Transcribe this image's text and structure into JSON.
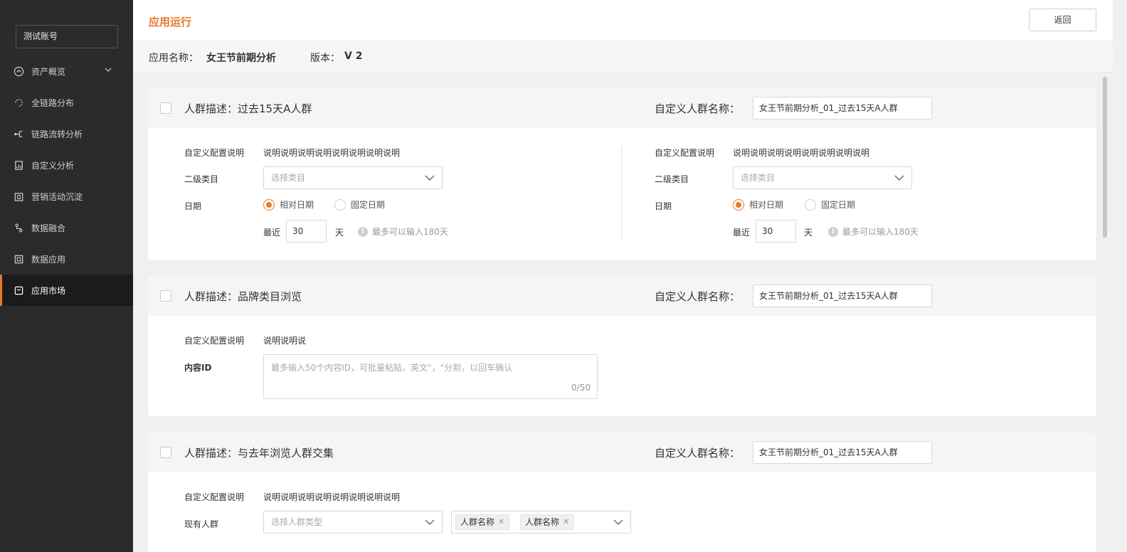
{
  "sidebar": {
    "account": "测试账号",
    "items": [
      {
        "label": "资产概览",
        "icon": "dashboard-icon",
        "active": false,
        "has_children": true
      },
      {
        "label": "全链路分布",
        "icon": "loop-icon",
        "active": false
      },
      {
        "label": "链路流转分析",
        "icon": "flow-icon",
        "active": false
      },
      {
        "label": "自定义分析",
        "icon": "report-icon",
        "active": false
      },
      {
        "label": "营销活动沉淀",
        "icon": "campaign-icon",
        "active": false
      },
      {
        "label": "数据融合",
        "icon": "merge-icon",
        "active": false
      },
      {
        "label": "数据应用",
        "icon": "data-app-icon",
        "active": false
      },
      {
        "label": "应用市场",
        "icon": "market-icon",
        "active": true
      }
    ]
  },
  "header": {
    "title": "应用运行",
    "back_label": "返回"
  },
  "info": {
    "app_name_label": "应用名称：",
    "app_name": "女王节前期分析",
    "version_label": "版本：",
    "version": "V 2"
  },
  "cards": [
    {
      "desc": "人群描述：过去15天A人群",
      "custom_name_label": "自定义人群名称：",
      "custom_name_value": "女王节前期分析_01_过去15天A人群",
      "columns": [
        {
          "config_label": "自定义配置说明",
          "config_value": "说明说明说明说明说明说明说明说明",
          "category_label": "二级类目",
          "category_placeholder": "选择类目",
          "date_label": "日期",
          "radio_relative": "相对日期",
          "radio_fixed": "固定日期",
          "recent_label": "最近",
          "recent_value": "30",
          "unit": "天",
          "hint": "最多可以输入180天"
        },
        {
          "config_label": "自定义配置说明",
          "config_value": "说明说明说明说明说明说明说明说明",
          "category_label": "二级类目",
          "category_placeholder": "选择类目",
          "date_label": "日期",
          "radio_relative": "相对日期",
          "radio_fixed": "固定日期",
          "recent_label": "最近",
          "recent_value": "30",
          "unit": "天",
          "hint": "最多可以输入180天"
        }
      ]
    },
    {
      "desc": "人群描述：品牌类目浏览",
      "custom_name_label": "自定义人群名称：",
      "custom_name_value": "女王节前期分析_01_过去15天A人群",
      "config_label": "自定义配置说明",
      "config_value": "说明说明说",
      "content_id_label": "内容ID",
      "content_id_placeholder": "最多输入50个内容ID，可批量粘贴，英文\"，\"分割，以回车确认",
      "content_id_count": "0/50"
    },
    {
      "desc": "人群描述：与去年浏览人群交集",
      "custom_name_label": "自定义人群名称：",
      "custom_name_value": "女王节前期分析_01_过去15天A人群",
      "config_label": "自定义配置说明",
      "config_value": "说明说明说明说明说明说明说明说明",
      "existing_label": "现有人群",
      "existing_placeholder": "选择人群类型",
      "tags": [
        "人群名称",
        "人群名称"
      ]
    }
  ],
  "colors": {
    "accent": "#e8782a",
    "sidebar_bg": "#2b2b2b"
  }
}
